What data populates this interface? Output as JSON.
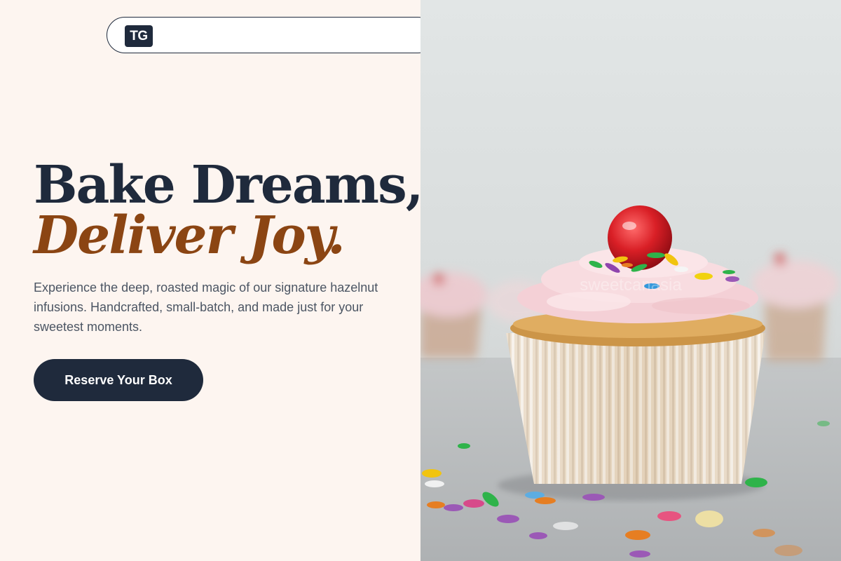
{
  "brand": {
    "logo_text": "TG"
  },
  "hero": {
    "title_line1": "Bake Dreams,",
    "title_line2": "Deliver Joy.",
    "description": "Experience the deep, roasted magic of our signature hazelnut infusions. Handcrafted, small-batch, and made just for your sweetest moments.",
    "cta_label": "Reserve Your Box"
  },
  "image": {
    "watermark": "sweetcanasia"
  },
  "colors": {
    "navy": "#1f2a3c",
    "accent_brown": "#8b4513",
    "cream_background": "#fdf5f0"
  }
}
